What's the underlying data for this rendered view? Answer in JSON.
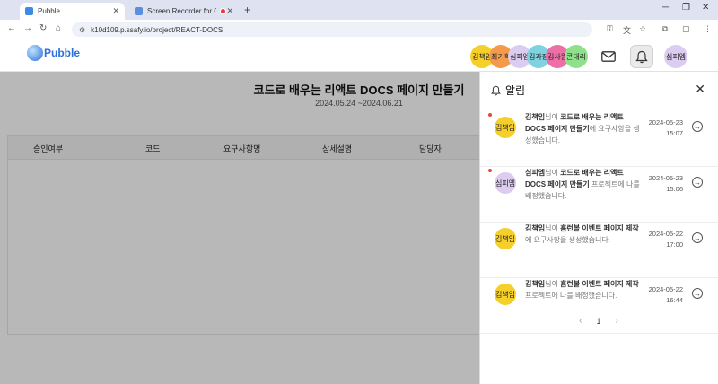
{
  "browser": {
    "tabs": [
      {
        "title": "Pubble",
        "active": true
      },
      {
        "title": "Screen Recorder for Goog",
        "active": false
      }
    ],
    "url": "k10d109.p.ssafy.io/project/REACT-DOCS"
  },
  "header": {
    "logo_text": "Pubble",
    "members": [
      {
        "name": "김책임",
        "color": "#f5cf2a"
      },
      {
        "name": "최기획",
        "color": "#f39a4c"
      },
      {
        "name": "심피엠",
        "color": "#dccdf0"
      },
      {
        "name": "김과장",
        "color": "#7fd3e0"
      },
      {
        "name": "김사원",
        "color": "#ee6fa6"
      },
      {
        "name": "콘대리",
        "color": "#8fe08a"
      }
    ],
    "user_name": "심피엠",
    "user_color": "#dccdf0",
    "mail_icon": "mail-icon",
    "bell_icon": "bell-icon"
  },
  "project": {
    "title": "코드로 배우는 리액트 DOCS 페이지 만들기",
    "dates": "2024.05.24 ~2024.06.21",
    "columns": [
      "승인여부",
      "코드",
      "요구사항명",
      "상세설명",
      "담당자"
    ]
  },
  "notifications": {
    "title": "알림",
    "items": [
      {
        "unread": true,
        "avatar": "김책임",
        "avatar_color": "#f5cf2a",
        "actor": "김책임",
        "suffix": "님이",
        "project": "코드로 배우는 리액트 DOCS 페이지 만들기",
        "message": "에 요구사항을 생성했습니다.",
        "date": "2024-05-23",
        "time": "15:07"
      },
      {
        "unread": true,
        "avatar": "심피엠",
        "avatar_color": "#dccdf0",
        "actor": "심피엠",
        "suffix": "님이",
        "project": "코드로 배우는 리액트 DOCS 페이지 만들기",
        "message": " 프로젝트에 나를 배정했습니다.",
        "date": "2024-05-23",
        "time": "15:06"
      },
      {
        "unread": false,
        "avatar": "김책임",
        "avatar_color": "#f5cf2a",
        "actor": "김책임",
        "suffix": "님이",
        "project": "홈런볼 이벤트 페이지 제작",
        "message": "에 요구사항을 생성했습니다.",
        "date": "2024-05-22",
        "time": "17:00"
      },
      {
        "unread": false,
        "avatar": "김책임",
        "avatar_color": "#f5cf2a",
        "actor": "김책임",
        "suffix": "님이",
        "project": "홈런볼 이벤트 페이지 제작",
        "message": " 프로젝트에 나를 배정했습니다.",
        "date": "2024-05-22",
        "time": "16:44"
      }
    ],
    "page": "1"
  }
}
